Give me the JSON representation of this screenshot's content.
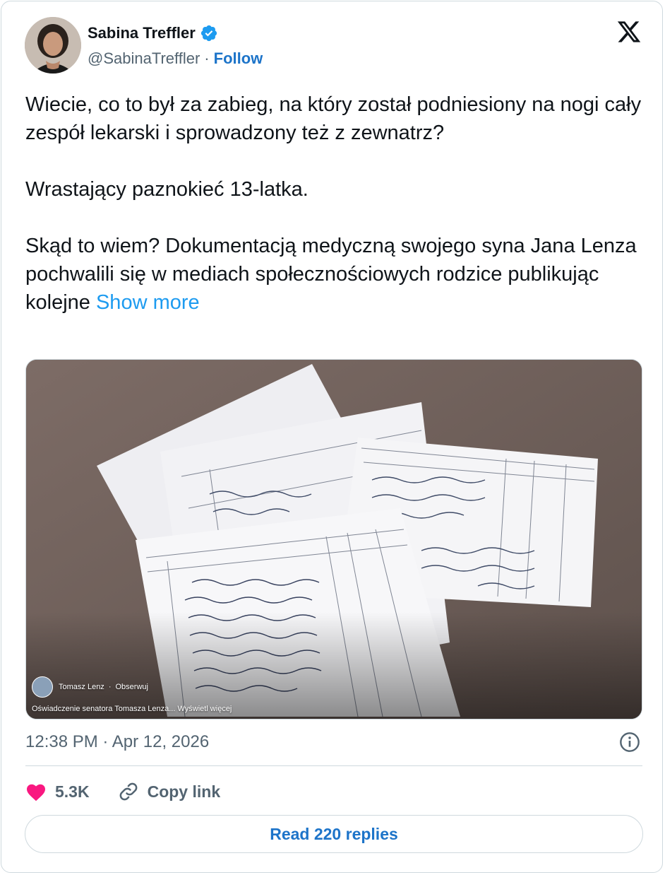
{
  "author": {
    "name": "Sabina Treffler",
    "handle": "@SabinaTreffler",
    "separator": "·",
    "follow_label": "Follow",
    "verified_icon": "verified-badge-icon",
    "colors": {
      "verified": "#1d9bf0",
      "follow": "#1d74c9"
    }
  },
  "brand": {
    "logo_icon": "x-logo-icon"
  },
  "tweet": {
    "paragraph_1": "Wiecie, co to był za zabieg, na który został podniesiony na nogi cały zespół lekarski i sprowadzony też z zewnatrz?",
    "paragraph_2": "Wrastający paznokieć 13-latka.",
    "paragraph_3": "Skąd to wiem? Dokumentacją medyczną swojego syna Jana Lenza pochwalili się w mediach społecznościowych rodzice publikując kolejne",
    "show_more": "Show more",
    "colors": {
      "show_more": "#1d9bf0"
    }
  },
  "media": {
    "overlay_author": "Tomasz Lenz",
    "overlay_separator": "·",
    "overlay_action": "Obserwuj",
    "overlay_caption": "Oświadczenie senatora Tomasza Lenza... Wyświetl więcej"
  },
  "meta": {
    "timestamp": "12:38 PM · Apr 12, 2026",
    "info_icon": "info-icon"
  },
  "actions": {
    "like_count": "5.3K",
    "like_icon": "heart-icon",
    "copy_link_label": "Copy link",
    "copy_icon": "link-icon",
    "colors": {
      "heart": "#f91880"
    }
  },
  "replies": {
    "label": "Read 220 replies"
  }
}
